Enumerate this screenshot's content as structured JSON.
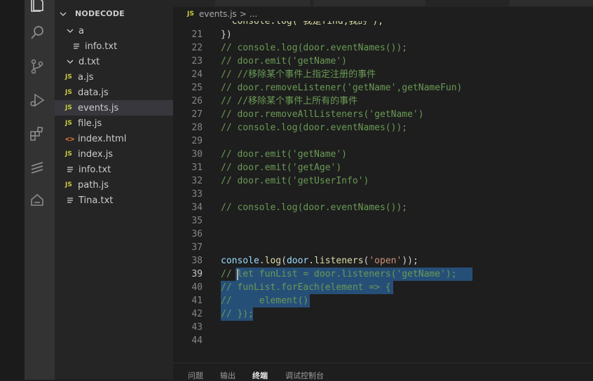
{
  "explorer": {
    "title": "NODECODE",
    "items": [
      {
        "label": "a",
        "type": "folder"
      },
      {
        "label": "info.txt",
        "type": "txt"
      },
      {
        "label": "d.txt",
        "type": "folder"
      },
      {
        "label": "a.js",
        "type": "js"
      },
      {
        "label": "data.js",
        "type": "js"
      },
      {
        "label": "events.js",
        "type": "js",
        "active": true
      },
      {
        "label": "file.js",
        "type": "js"
      },
      {
        "label": "index.html",
        "type": "html"
      },
      {
        "label": "index.js",
        "type": "js"
      },
      {
        "label": "info.txt",
        "type": "txt"
      },
      {
        "label": "path.js",
        "type": "js"
      },
      {
        "label": "Tina.txt",
        "type": "txt"
      }
    ]
  },
  "icons": {
    "js": "JS",
    "html": "<>"
  },
  "breadcrumb": {
    "file": "events.js",
    "separator": ">",
    "rest": "..."
  },
  "editor": {
    "partial_top": "  console.log('我是find,我的');",
    "lines": [
      {
        "n": "21",
        "code": "})"
      },
      {
        "n": "22",
        "code": "// console.log(door.eventNames());"
      },
      {
        "n": "23",
        "code": "// door.emit('getName')"
      },
      {
        "n": "24",
        "code": "// //移除某个事件上指定注册的事件"
      },
      {
        "n": "25",
        "code": "// door.removeListener('getName',getNameFun)"
      },
      {
        "n": "26",
        "code": "// //移除某个事件上所有的事件"
      },
      {
        "n": "27",
        "code": "// door.removeAllListeners('getName')"
      },
      {
        "n": "28",
        "code": "// console.log(door.eventNames());"
      },
      {
        "n": "29",
        "code": ""
      },
      {
        "n": "30",
        "code": "// door.emit('getName')"
      },
      {
        "n": "31",
        "code": "// door.emit('getAge')"
      },
      {
        "n": "32",
        "code": "// door.emit('getUserInfo')"
      },
      {
        "n": "33",
        "code": ""
      },
      {
        "n": "34",
        "code": "// console.log(door.eventNames());"
      },
      {
        "n": "35",
        "code": ""
      },
      {
        "n": "36",
        "code": ""
      },
      {
        "n": "37",
        "code": ""
      },
      {
        "n": "38",
        "code": "console.log(door.listeners('open'));"
      },
      {
        "n": "39",
        "code": "// let funList = door.listeners('getName');"
      },
      {
        "n": "40",
        "code": "// funList.forEach(element => {"
      },
      {
        "n": "41",
        "code": "//     element()"
      },
      {
        "n": "42",
        "code": "// });"
      },
      {
        "n": "43",
        "code": ""
      },
      {
        "n": "44",
        "code": ""
      }
    ]
  },
  "panel": {
    "tabs": [
      "问题",
      "输出",
      "终端",
      "调试控制台"
    ],
    "active": "终端"
  }
}
